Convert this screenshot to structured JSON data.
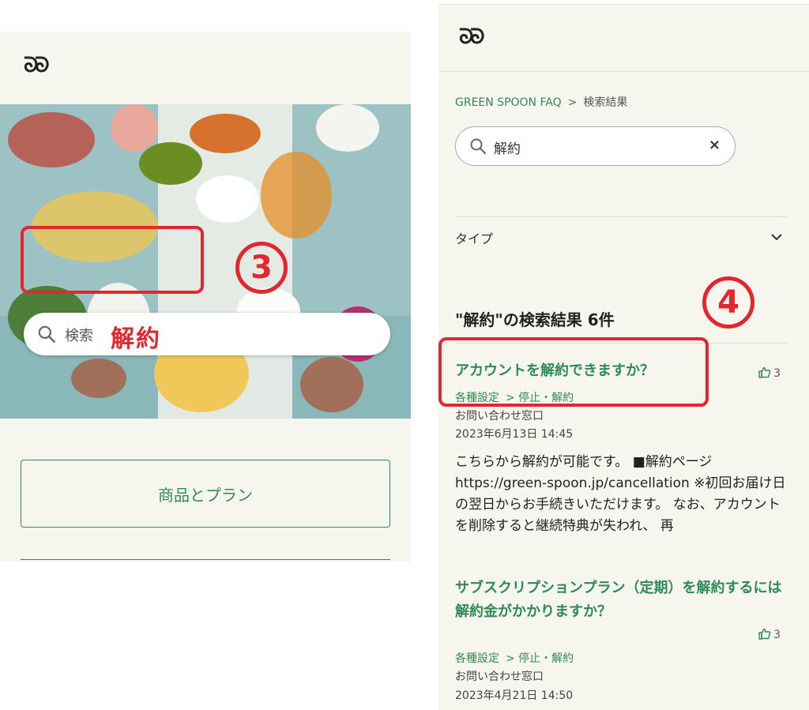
{
  "left": {
    "logo": "ᘐᘐ",
    "search_placeholder": "検索",
    "search_typed": "解約",
    "step_number": "3",
    "plan_button": "商品とプラン"
  },
  "right": {
    "logo": "ᘐᘐ",
    "breadcrumb": {
      "home": "GREEN SPOON FAQ",
      "separator": ">",
      "current": "検索結果"
    },
    "search_value": "解約",
    "clear_icon": "×",
    "type_label": "タイプ",
    "step_number": "4",
    "results_title": "\"解約\"の検索結果 6件",
    "results": [
      {
        "title": "アカウントを解約できますか？",
        "likes": "3",
        "category": "各種設定",
        "subcategory": "> 停止・解約",
        "author": "お問い合わせ窓口",
        "date": "2023年6月13日 14:45",
        "snippet": "こちらから解約が可能です。 ■解約ページ https://green-spoon.jp/cancellation ※初回お届け日の翌日からお手続きいただけます。 なお、アカウントを削除すると継続特典が失われ、 再"
      },
      {
        "title": "サブスクリプションプラン（定期）を解約するには解約金がかかりますか？",
        "likes": "3",
        "category": "各種設定",
        "subcategory": "> 停止・解約",
        "author": "お問い合わせ窓口",
        "date": "2023年4月21日 14:50"
      }
    ]
  },
  "colors": {
    "brand_green": "#2e8b57",
    "annotation_red": "#e2282e",
    "background": "#f7f6ee"
  }
}
